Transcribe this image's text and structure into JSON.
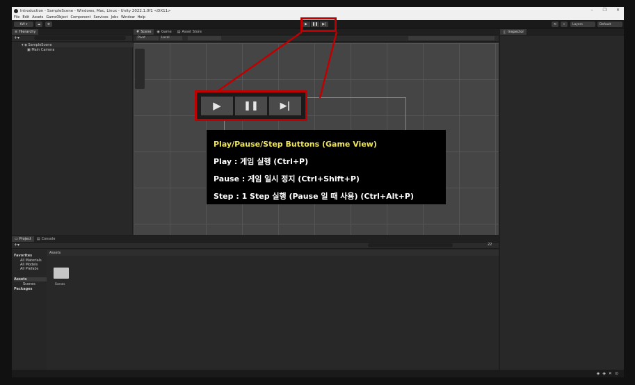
{
  "window": {
    "title": "Introduction - SampleScene - Windows, Mac, Linux - Unity 2022.1.0f1 <DX11>",
    "controls": [
      "–",
      "❐",
      "✕"
    ]
  },
  "menu": [
    "File",
    "Edit",
    "Assets",
    "GameObject",
    "Component",
    "Services",
    "Jobs",
    "Window",
    "Help"
  ],
  "toolbar": {
    "account": "KW ▾",
    "layers": "Layers",
    "layout": "Default",
    "play": "▶",
    "pause": "❚❚",
    "step": "▶|"
  },
  "hierarchy": {
    "tab": "Hierarchy",
    "scene": "SampleScene",
    "items": [
      "Main Camera"
    ]
  },
  "scene_tabs": [
    "Scene",
    "Game",
    "Asset Store"
  ],
  "scene_toolbar": {
    "pivot": "Pivot",
    "local": "Local"
  },
  "inspector": {
    "tab": "Inspector"
  },
  "project": {
    "tabs": [
      "Project",
      "Console"
    ],
    "tree": [
      "Favorites",
      "All Materials",
      "All Models",
      "All Prefabs",
      "Assets",
      "Scenes",
      "Packages"
    ],
    "breadcrumb": "Assets",
    "folder": "Scenes",
    "count": "22"
  },
  "overlay": {
    "big_play": "▶",
    "big_pause": "❚❚",
    "big_step": "▶|",
    "heading": "Play/Pause/Step Buttons (Game View)",
    "lines": [
      "Play : 게임 실행 (Ctrl+P)",
      "Pause : 게임 일시 정지 (Ctrl+Shift+P)",
      "Step : 1 Step 실행 (Pause 일 때 사용) (Ctrl+Alt+P)"
    ],
    "accent_color": "#c00000",
    "heading_color": "#f0e55a"
  }
}
